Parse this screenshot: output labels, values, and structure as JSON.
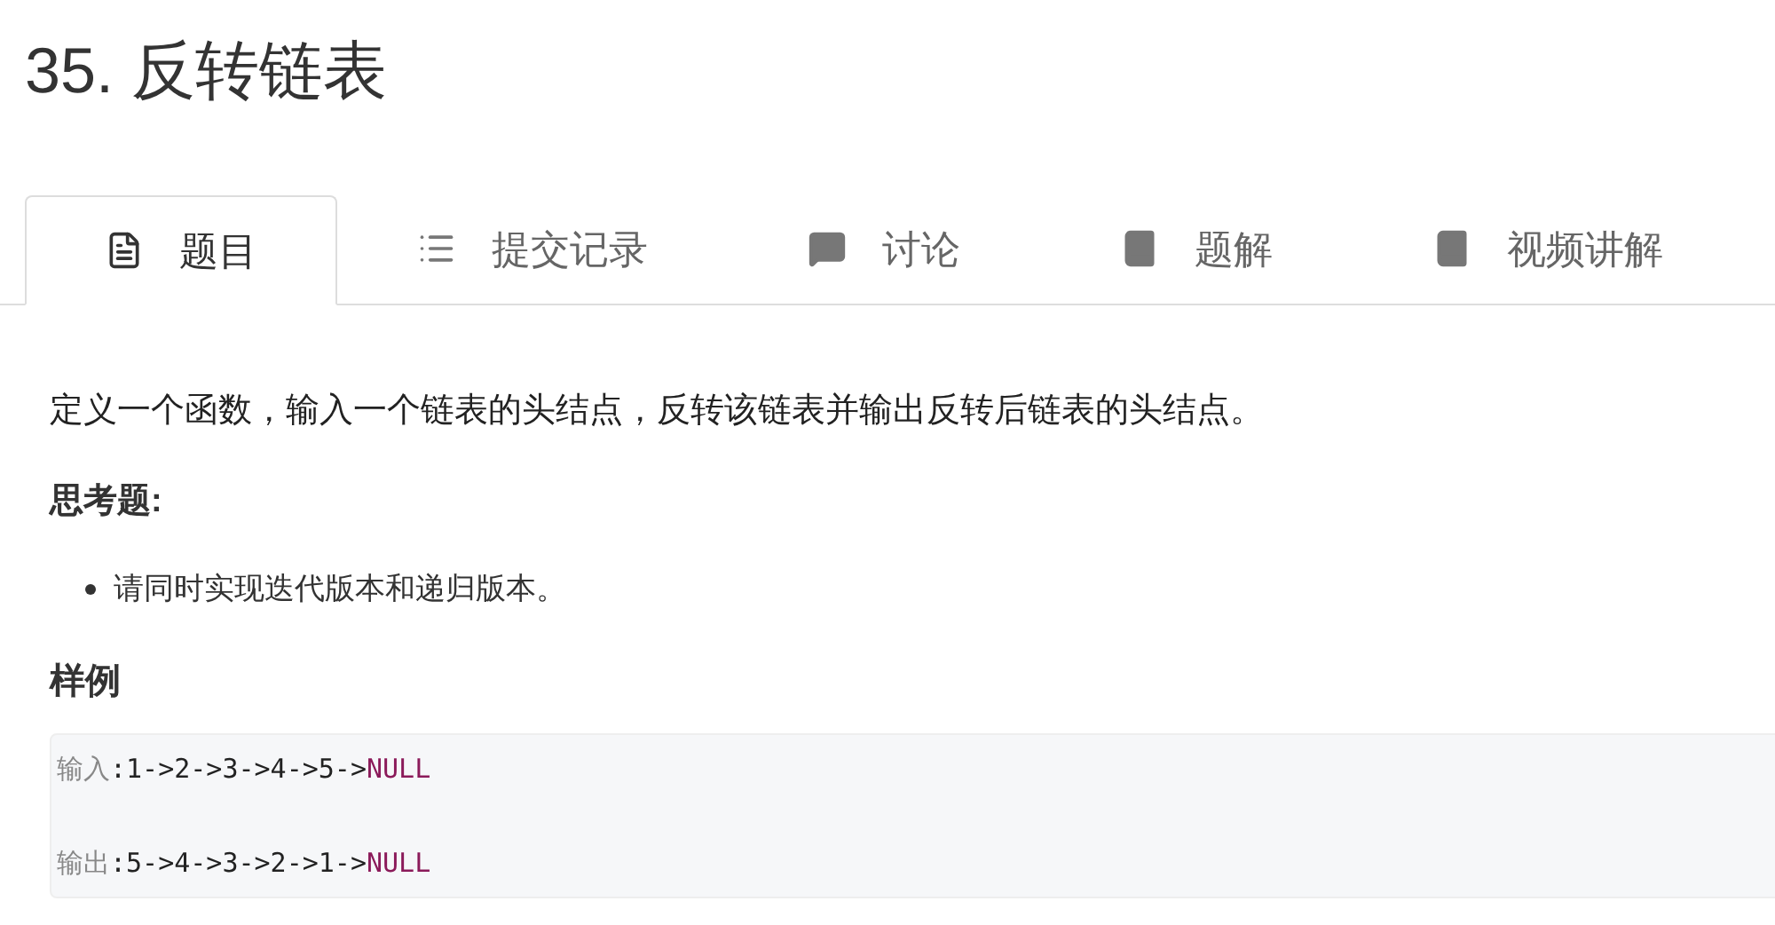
{
  "title": "35. 反转链表",
  "tabs": [
    {
      "label": "题目",
      "kind": "document",
      "selected": true
    },
    {
      "label": "提交记录",
      "kind": "list",
      "selected": false
    },
    {
      "label": "讨论",
      "kind": "comment",
      "selected": false
    },
    {
      "label": "题解",
      "kind": "book",
      "selected": false
    },
    {
      "label": "视频讲解",
      "kind": "book",
      "selected": false
    }
  ],
  "description": "定义一个函数，输入一个链表的头结点，反转该链表并输出反转后链表的头结点。",
  "thinking_heading": "思考题:",
  "thinking_items": [
    "请同时实现迭代版本和递归版本。"
  ],
  "sample_heading": "样例",
  "code_lines": [
    [
      {
        "kind": "label",
        "text": "输入"
      },
      {
        "kind": "plain",
        "text": ":1->2->3->4->5->"
      },
      {
        "kind": "keyword",
        "text": "NULL"
      }
    ],
    [
      {
        "kind": "label",
        "text": "输出"
      },
      {
        "kind": "plain",
        "text": ":5->4->3->2->1->"
      },
      {
        "kind": "keyword",
        "text": "NULL"
      }
    ]
  ]
}
